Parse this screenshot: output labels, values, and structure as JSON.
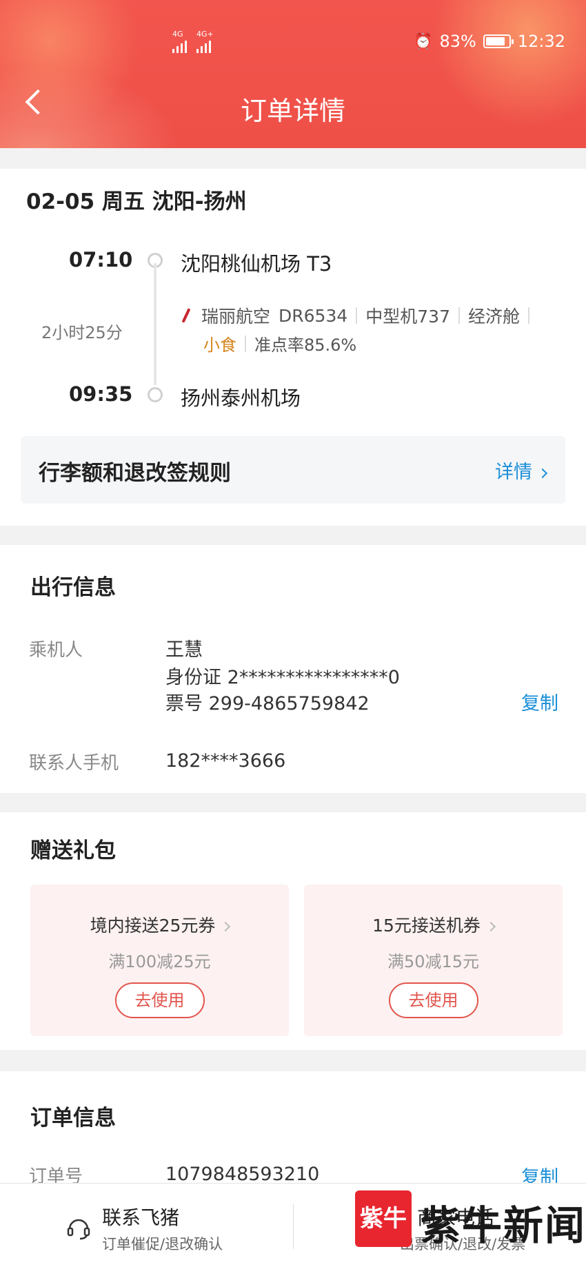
{
  "status_bar": {
    "network_left": "4G",
    "network_right": "4G+",
    "battery_percent": "83%",
    "battery_level": 0.83,
    "time": "12:32"
  },
  "header": {
    "title": "订单详情",
    "back_icon": "chevron-left-icon"
  },
  "flight": {
    "date_route": "02-05 周五 沈阳-扬州",
    "depart_time": "07:10",
    "depart_airport": "沈阳桃仙机场 T3",
    "duration": "2小时25分",
    "airline": "瑞丽航空",
    "flight_no": "DR6534",
    "aircraft": "中型机737",
    "cabin": "经济舱",
    "meal": "小食",
    "ontime": "准点率85.6%",
    "arrive_time": "09:35",
    "arrive_airport": "扬州泰州机场",
    "rules_title": "行李额和退改签规则",
    "rules_more": "详情"
  },
  "travel": {
    "title": "出行信息",
    "passenger_label": "乘机人",
    "passenger_name": "王慧",
    "id_card": "身份证 2****************0",
    "ticket_no": "票号 299-4865759842",
    "copy_label": "复制",
    "contact_label": "联系人手机",
    "contact_phone": "182****3666"
  },
  "gift": {
    "title": "赠送礼包",
    "coupons": [
      {
        "name": "境内接送25元券",
        "desc": "满100减25元",
        "button": "去使用"
      },
      {
        "name": "15元接送机券",
        "desc": "满50减15元",
        "button": "去使用"
      }
    ]
  },
  "order": {
    "title": "订单信息",
    "order_no_label": "订单号",
    "order_no": "1079848593210",
    "copy_label": "复制"
  },
  "bottom": {
    "contact_title": "联系飞猪",
    "contact_sub": "订单催促/退改确认",
    "merchant_title": "商家电话",
    "merchant_sub": "出票确认/退改/发票"
  },
  "watermark": {
    "logo_text": "紫牛",
    "text": "紫牛新闻"
  },
  "colors": {
    "header_red": "#f0524a",
    "link_blue": "#1a8fd8",
    "accent_red": "#e2544c",
    "snack_orange": "#d6841b"
  }
}
